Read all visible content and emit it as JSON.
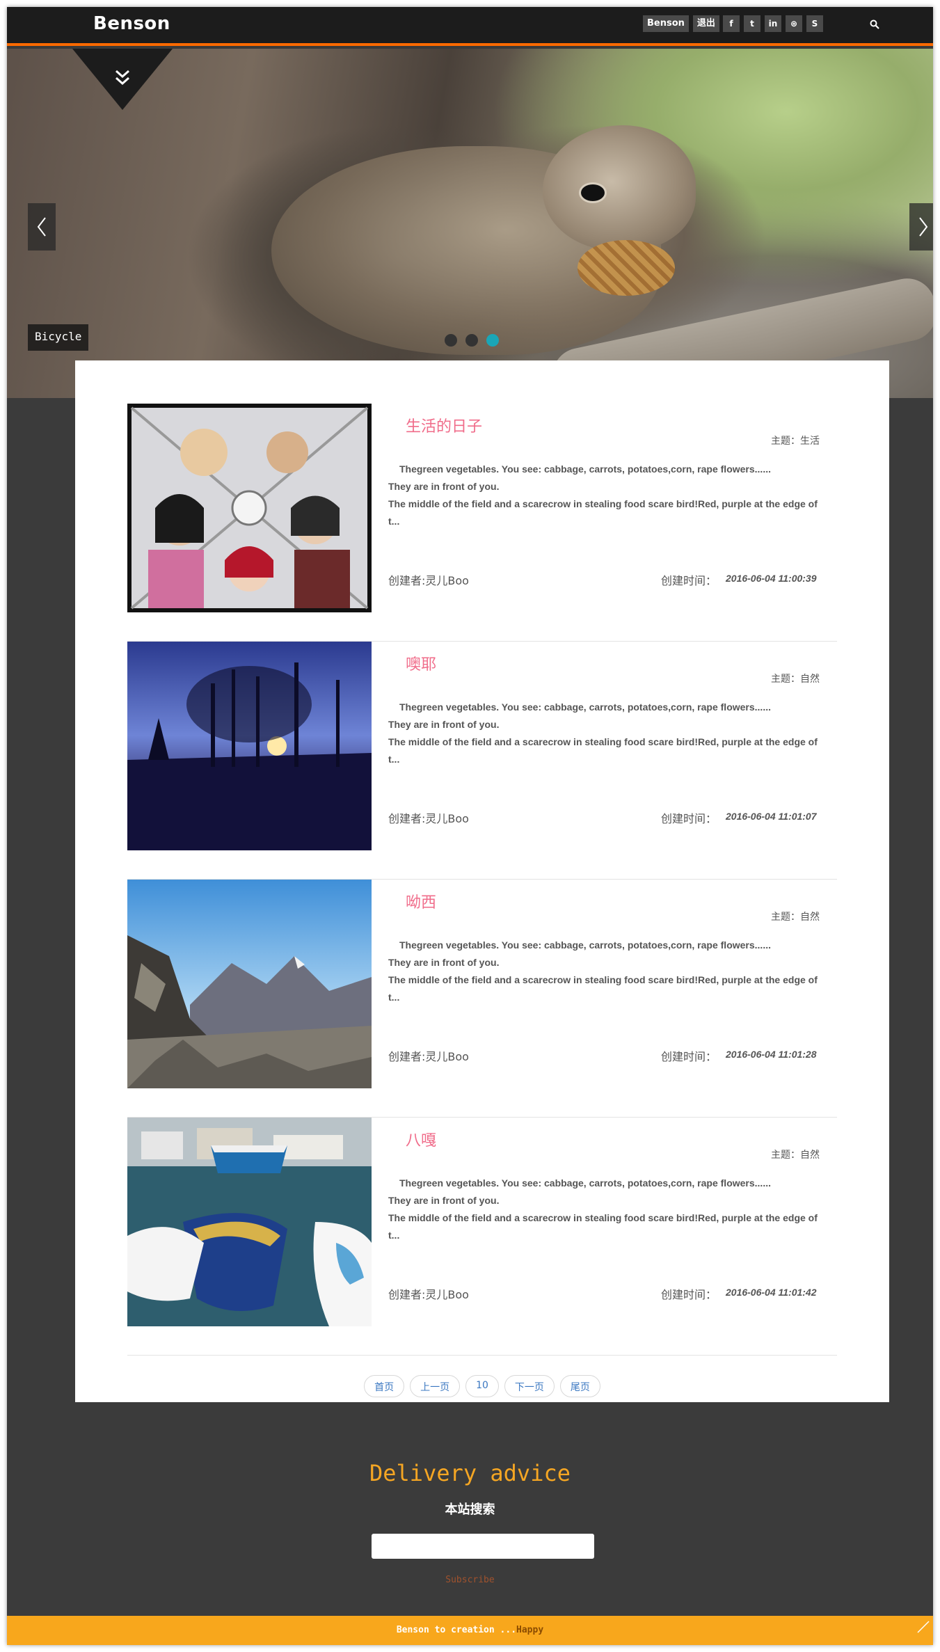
{
  "brand": "Benson",
  "user_links": [
    "Benson",
    "退出"
  ],
  "social": [
    {
      "icon": "facebook-icon",
      "glyph": "f"
    },
    {
      "icon": "twitter-icon",
      "glyph": "t"
    },
    {
      "icon": "linkedin-icon",
      "glyph": "in"
    },
    {
      "icon": "dribbble-icon",
      "glyph": "⊛"
    },
    {
      "icon": "skype-icon",
      "glyph": "S"
    }
  ],
  "hero": {
    "caption": "Bicycle",
    "slides": 3,
    "active_slide": 3
  },
  "posts": [
    {
      "title": "生活的日子",
      "topic": "主题：生活",
      "excerpt_1": "Thegreen vegetables. You see: cabbage, carrots, potatoes,corn, rape flowers......",
      "excerpt_2": "They are in front of you.",
      "excerpt_3": "The middle of the field and a scarecrow in stealing food scare bird!Red, purple at the edge of t...",
      "author": "创建者:灵儿Boo",
      "date_label": "创建时间：",
      "date": "2016-06-04 11:00:39"
    },
    {
      "title": "噢耶",
      "topic": "主题：自然",
      "excerpt_1": "Thegreen vegetables. You see: cabbage, carrots, potatoes,corn, rape flowers......",
      "excerpt_2": "They are in front of you.",
      "excerpt_3": "The middle of the field and a scarecrow in stealing food scare bird!Red, purple at the edge of t...",
      "author": "创建者:灵儿Boo",
      "date_label": "创建时间：",
      "date": "2016-06-04 11:01:07"
    },
    {
      "title": "呦西",
      "topic": "主题：自然",
      "excerpt_1": "Thegreen vegetables. You see: cabbage, carrots, potatoes,corn, rape flowers......",
      "excerpt_2": "They are in front of you.",
      "excerpt_3": "The middle of the field and a scarecrow in stealing food scare bird!Red, purple at the edge of t...",
      "author": "创建者:灵儿Boo",
      "date_label": "创建时间：",
      "date": "2016-06-04 11:01:28"
    },
    {
      "title": "八嘎",
      "topic": "主题：自然",
      "excerpt_1": "Thegreen vegetables. You see: cabbage, carrots, potatoes,corn, rape flowers......",
      "excerpt_2": "They are in front of you.",
      "excerpt_3": "The middle of the field and a scarecrow in stealing food scare bird!Red, purple at the edge of t...",
      "author": "创建者:灵儿Boo",
      "date_label": "创建时间：",
      "date": "2016-06-04 11:01:42"
    }
  ],
  "pager": [
    "首页",
    "上一页",
    "10",
    "下一页",
    "尾页"
  ],
  "footer": {
    "title": "Delivery advice",
    "search_label": "本站搜索",
    "input_value": "",
    "subscribe": "Subscribe",
    "bottom_prefix": "Benson to creation ...",
    "bottom_happy": "Happy"
  },
  "colors": {
    "accent_orange": "#ff6a00",
    "title_pink": "#f06c8a",
    "footer_bar": "#f8a71c",
    "active_dot": "#1aa6b7"
  }
}
